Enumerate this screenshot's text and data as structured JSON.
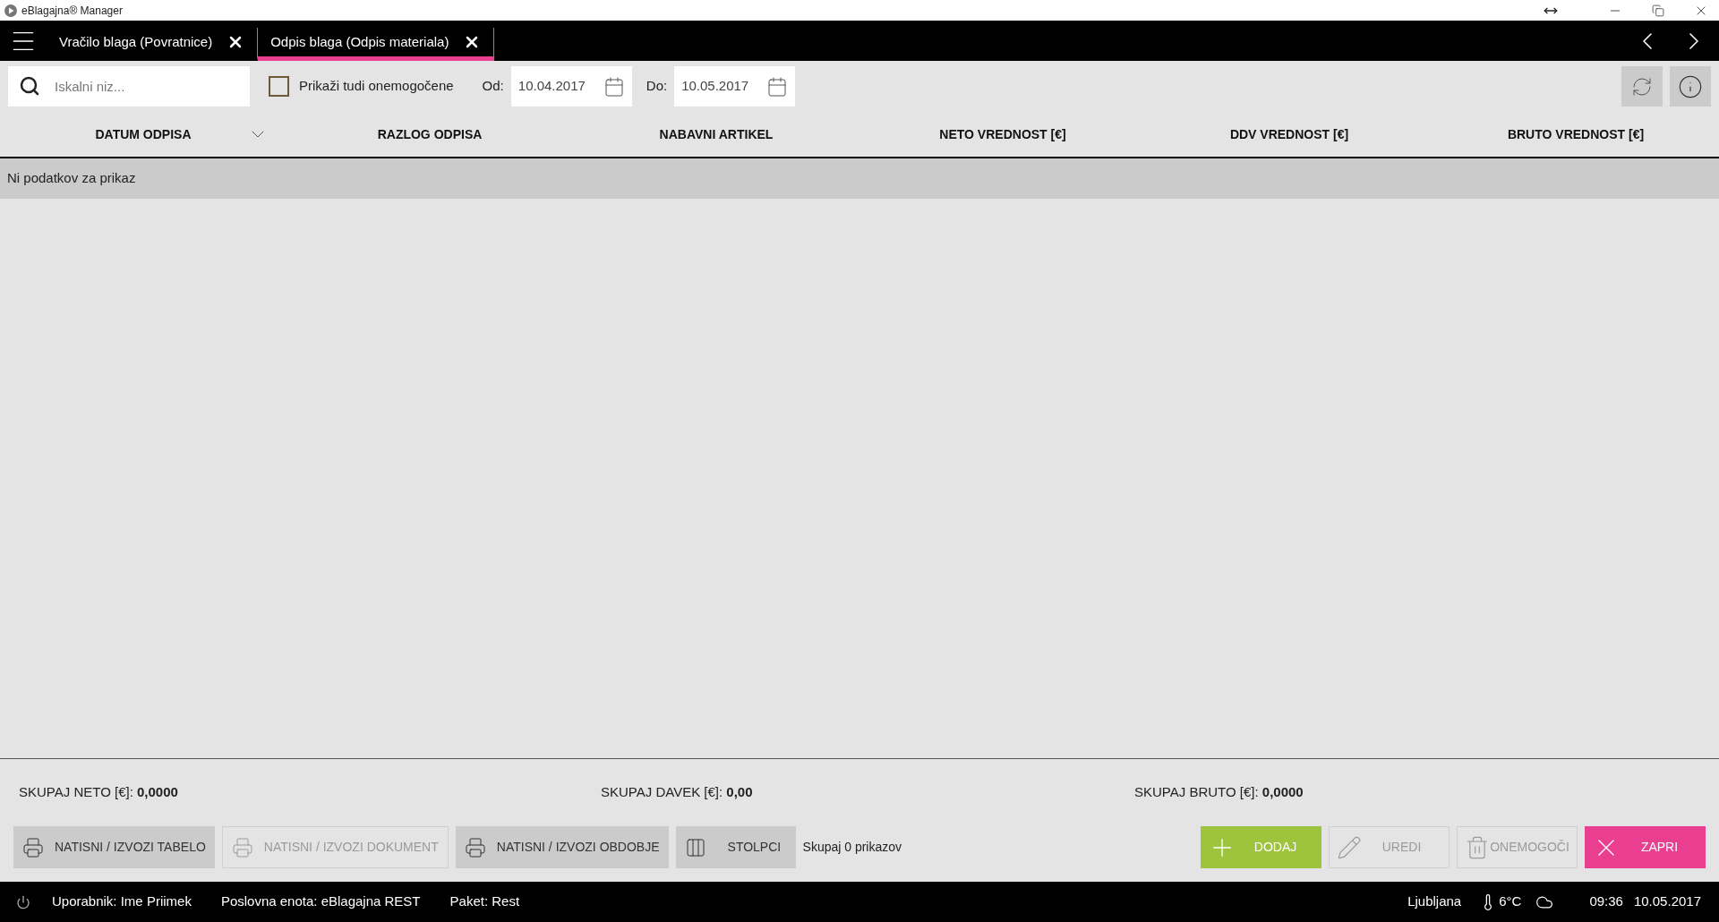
{
  "title_bar": {
    "title": "eBlagajna® Manager"
  },
  "tabs": [
    {
      "label": "Vračilo blaga (Povratnice)",
      "selected": false
    },
    {
      "label": "Odpis blaga (Odpis materiala)",
      "selected": true
    }
  ],
  "toolbar": {
    "search": {
      "placeholder": "Iskalni niz..."
    },
    "show_disabled": {
      "label": "Prikaži tudi onemogočene",
      "checked": false
    },
    "date_from": {
      "label": "Od:",
      "value": "10.04.2017"
    },
    "date_to": {
      "label": "Do:",
      "value": "10.05.2017"
    }
  },
  "table": {
    "columns": [
      {
        "label": "DATUM ODPISA",
        "sorted": true
      },
      {
        "label": "RAZLOG ODPISA",
        "sorted": false
      },
      {
        "label": "NABAVNI ARTIKEL",
        "sorted": false
      },
      {
        "label": "NETO VREDNOST [€]",
        "sorted": false
      },
      {
        "label": "DDV VREDNOST [€]",
        "sorted": false
      },
      {
        "label": "BRUTO VREDNOST [€]",
        "sorted": false
      }
    ],
    "empty_message": "Ni podatkov za prikaz"
  },
  "totals": [
    "SKUPAJ NETO [€]: **0,0000**",
    "SKUPAJ DAVEK [€]: **0,00**",
    "SKUPAJ BRUTO [€]: **0,0000**"
  ],
  "actions_left": [
    {
      "label": "NATISNI / IZVOZI TABELO",
      "kind": "print",
      "disabled": false
    },
    {
      "label": "NATISNI / IZVOZI DOKUMENT",
      "kind": "print",
      "disabled": true
    },
    {
      "label": "NATISNI / IZVOZI OBDOBJE",
      "kind": "print",
      "disabled": false
    },
    {
      "label": "STOLPCI",
      "kind": "columns",
      "disabled": false
    }
  ],
  "record_count": "Skupaj 0 prikazov",
  "actions_right": [
    {
      "label": "DODAJ",
      "kind": "add",
      "disabled": false
    },
    {
      "label": "UREDI",
      "kind": "edit",
      "disabled": true
    },
    {
      "label": "ONEMOGOČI",
      "kind": "delete",
      "disabled": true
    },
    {
      "label": "ZAPRI",
      "kind": "close",
      "disabled": false
    }
  ],
  "status_bar": {
    "user": "Uporabnik: Ime Priimek",
    "unit": "Poslovna enota: eBlagajna REST",
    "package": "Paket: Rest",
    "city": "Ljubljana",
    "temperature": "6°C",
    "time": "09:36",
    "date": "10.05.2017"
  }
}
